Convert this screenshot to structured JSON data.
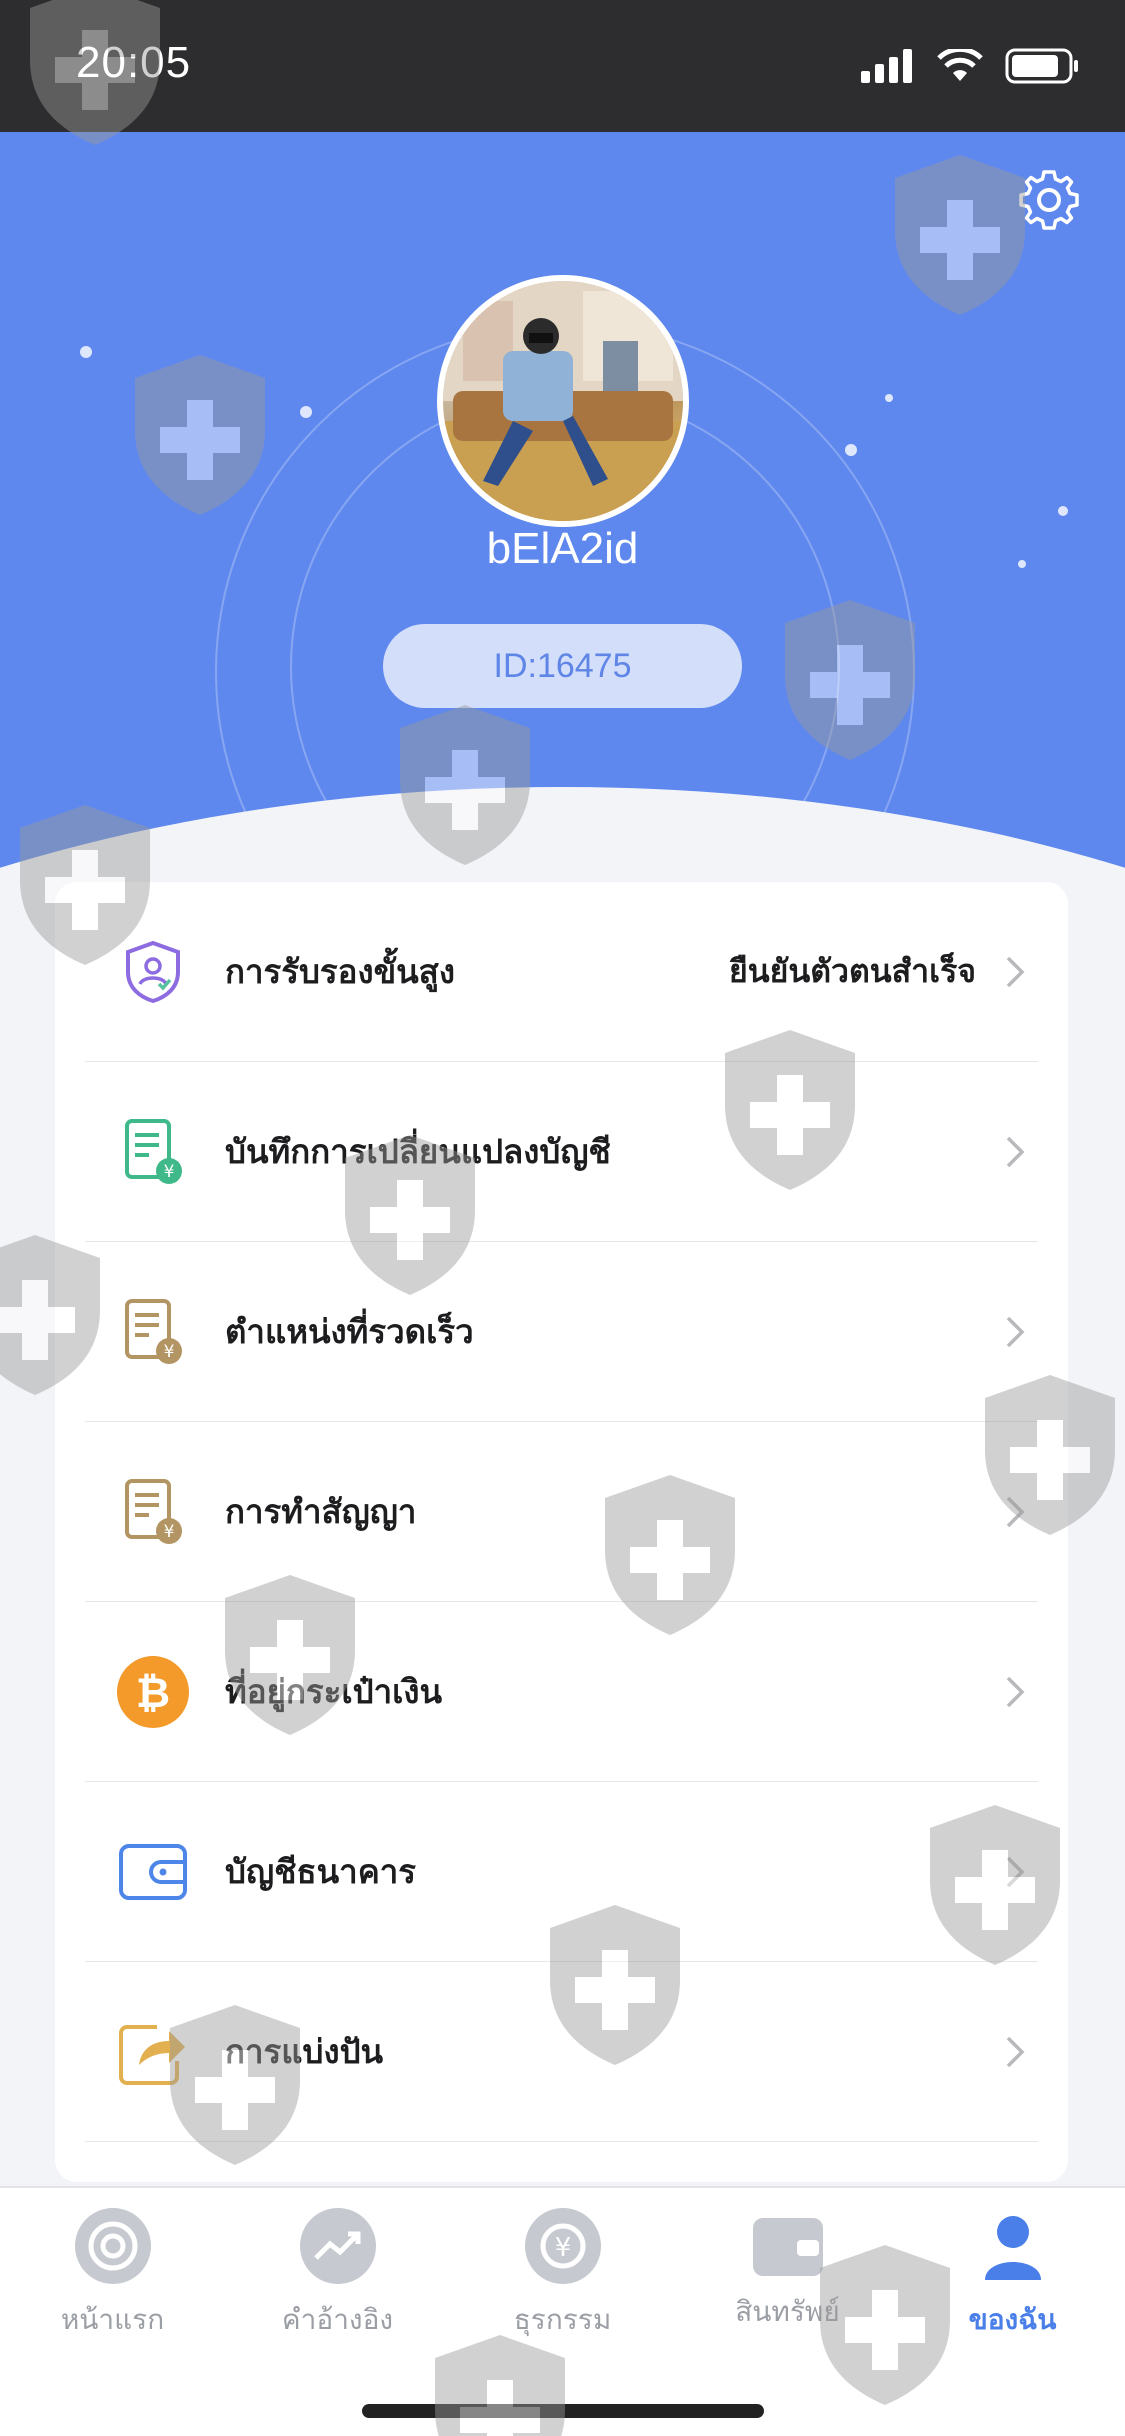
{
  "status_bar": {
    "time": "20:05"
  },
  "profile": {
    "username": "bElA2id",
    "id_label": "ID:16475"
  },
  "menu": [
    {
      "label": "การรับรองขั้นสูง",
      "value": "ยืนยันตัวตนสำเร็จ",
      "icon": "shield-user-icon"
    },
    {
      "label": "บันทึกการเปลี่ยนแปลงบัญชี",
      "value": "",
      "icon": "document-yen-icon"
    },
    {
      "label": "ตำแหน่งที่รวดเร็ว",
      "value": "",
      "icon": "document-yen-icon"
    },
    {
      "label": "การทำสัญญา",
      "value": "",
      "icon": "document-yen-icon"
    },
    {
      "label": "ที่อยู่กระเป๋าเงิน",
      "value": "",
      "icon": "bitcoin-icon"
    },
    {
      "label": "บัญชีธนาคาร",
      "value": "",
      "icon": "wallet-icon"
    },
    {
      "label": "การแบ่งปัน",
      "value": "",
      "icon": "share-icon"
    }
  ],
  "tabs": [
    {
      "label": "หน้าแรก",
      "icon": "home-icon",
      "active": false
    },
    {
      "label": "คำอ้างอิง",
      "icon": "trend-icon",
      "active": false
    },
    {
      "label": "ธุรกรรม",
      "icon": "exchange-icon",
      "active": false
    },
    {
      "label": "สินทรัพย์",
      "icon": "wallet-icon",
      "active": false
    },
    {
      "label": "ของฉัน",
      "icon": "user-icon",
      "active": true
    }
  ],
  "colors": {
    "header_blue": "#5f88ee",
    "accent": "#4a7ee8",
    "status_bar": "#2d2d2f"
  }
}
